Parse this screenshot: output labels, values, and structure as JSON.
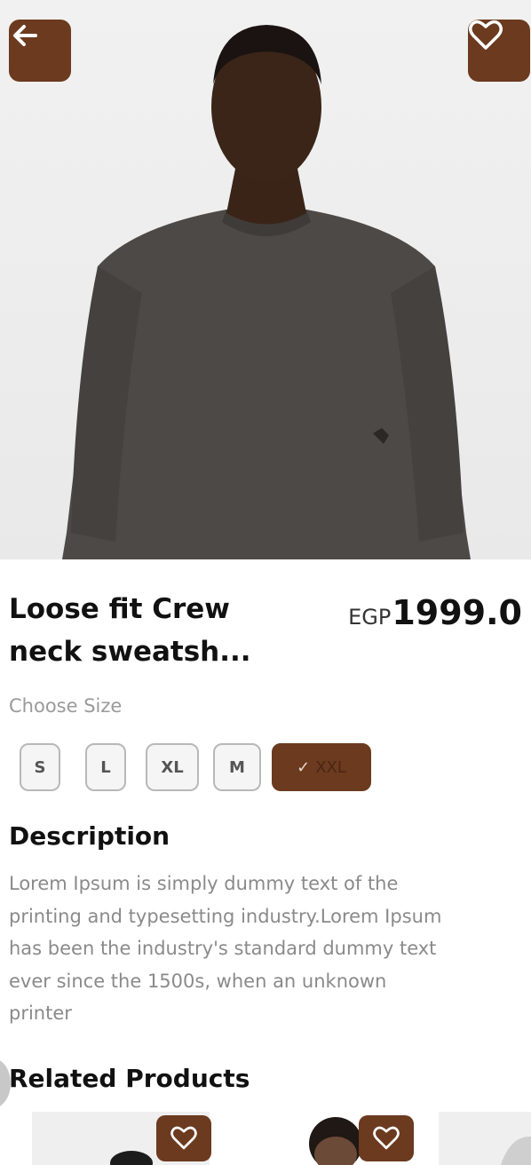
{
  "colors": {
    "accent": "#6b3a1f",
    "title_text": "#111111",
    "muted_text": "#8a8a8a"
  },
  "header": {
    "back_icon": "arrow-left-icon",
    "favorite_icon": "heart-outline-icon"
  },
  "product": {
    "title_line1": "Loose fit Crew",
    "title_line2": "neck sweatsh...",
    "currency": "EGP",
    "price": "1999.0",
    "choose_size_label": "Choose Size",
    "sizes": [
      "S",
      "L",
      "XL",
      "M",
      "XXL"
    ],
    "selected_size": "XXL",
    "selected_icon": "check-icon",
    "description_title": "Description",
    "description_lines": [
      "Lorem Ipsum is simply dummy text of the",
      "printing and typesetting industry.Lorem Ipsum",
      "has been the industry's standard dummy text",
      "ever since the 1500s, when an unknown",
      "printer"
    ]
  },
  "related": {
    "title": "Related Products",
    "card_favorite_icon": "heart-outline-icon"
  }
}
